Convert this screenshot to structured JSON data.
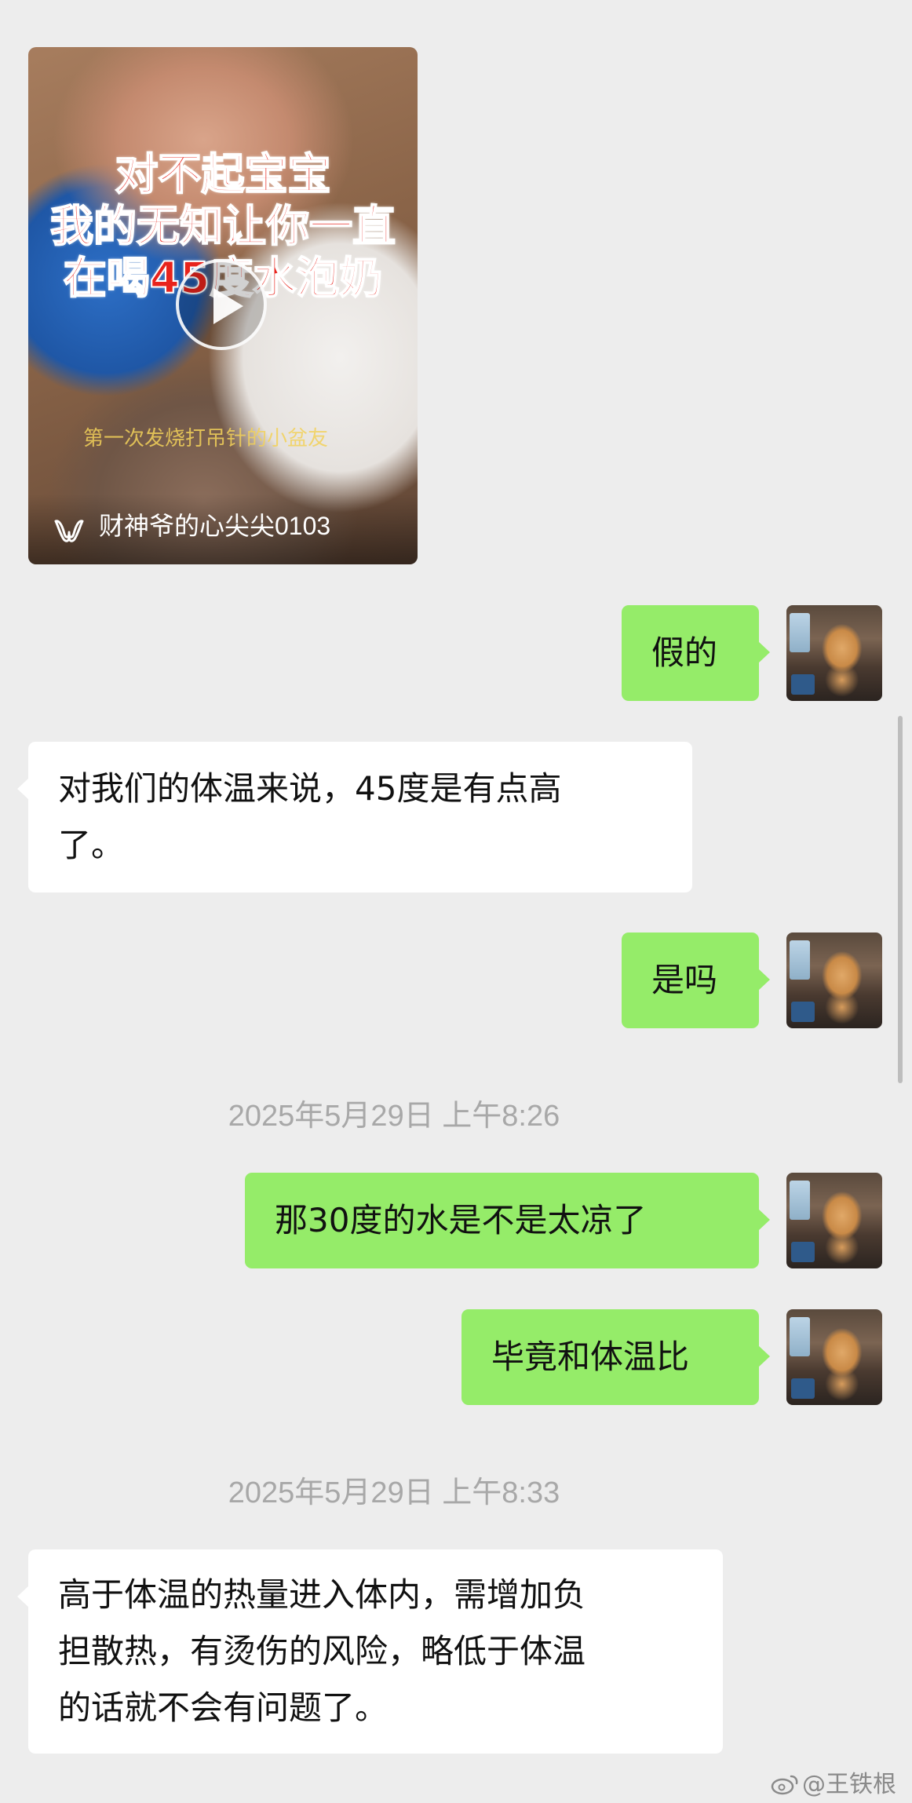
{
  "video": {
    "caption_line1": "对不起宝宝",
    "caption_line2": "我的无知让你一直",
    "caption_line3": "在喝45度水泡奶",
    "subtitle": "第一次发烧打吊针的小盆友",
    "channel_name": "财神爷的心尖尖0103",
    "icon": "channels-icon"
  },
  "messages": [
    {
      "side": "right",
      "text": "假的"
    },
    {
      "side": "left",
      "text": "对我们的体温来说，45度是有点高了。"
    },
    {
      "side": "right",
      "text": "是吗"
    },
    {
      "side": "right",
      "text": "那30度的水是不是太凉了"
    },
    {
      "side": "right",
      "text": "毕竟和体温比"
    },
    {
      "side": "left",
      "text": "高于体温的热量进入体内，需增加负担散热，有烫伤的风险，略低于体温的话就不会有问题了。"
    }
  ],
  "message_lines": {
    "m1_line1": "对我们的体温来说，45度是有点高",
    "m1_line2": "了。",
    "m5_line1": "高于体温的热量进入体内，需增加负",
    "m5_line2": "担散热，有烫伤的风险，略低于体温",
    "m5_line3": "的话就不会有问题了。"
  },
  "timestamps": [
    "2025年5月29日 上午8:26",
    "2025年5月29日 上午8:33"
  ],
  "watermark": "@王铁根",
  "colors": {
    "background": "#ededed",
    "sent_bubble": "#95ec69",
    "received_bubble": "#ffffff",
    "timestamp": "#a8a8a8",
    "caption_red": "#e8231c"
  }
}
